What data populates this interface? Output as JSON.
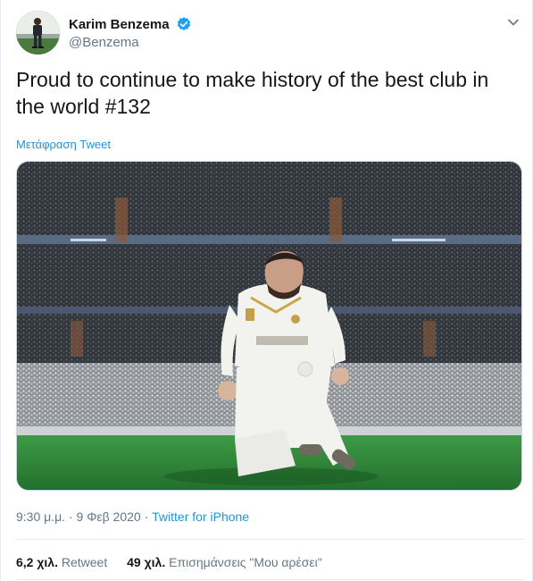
{
  "user": {
    "display_name": "Karim Benzema",
    "handle": "@Benzema",
    "verified": true,
    "avatar_icon": "profile-photo"
  },
  "tweet": {
    "text_line1": "Proud to continue to make history of the best club in",
    "text_line2": "the world #132",
    "translate_label": "Μετάφραση Tweet",
    "time": "9:30 μ.μ.",
    "date": "9 Φεβ 2020",
    "separator": "·",
    "source": "Twitter for iPhone"
  },
  "stats": {
    "retweets_count": "6,2 χιλ.",
    "retweets_label": "Retweet",
    "likes_count": "49 χιλ.",
    "likes_label": "Επισημάνσεις \"Μου αρέσει\""
  },
  "colors": {
    "link": "#1b95e0",
    "verified": "#1da1f2",
    "secondary_text": "#657786",
    "jersey": "#f2f2ee",
    "pitch": "#2f8a3a"
  },
  "icons": {
    "verified": "verified-badge-icon",
    "menu": "chevron-down-icon"
  }
}
